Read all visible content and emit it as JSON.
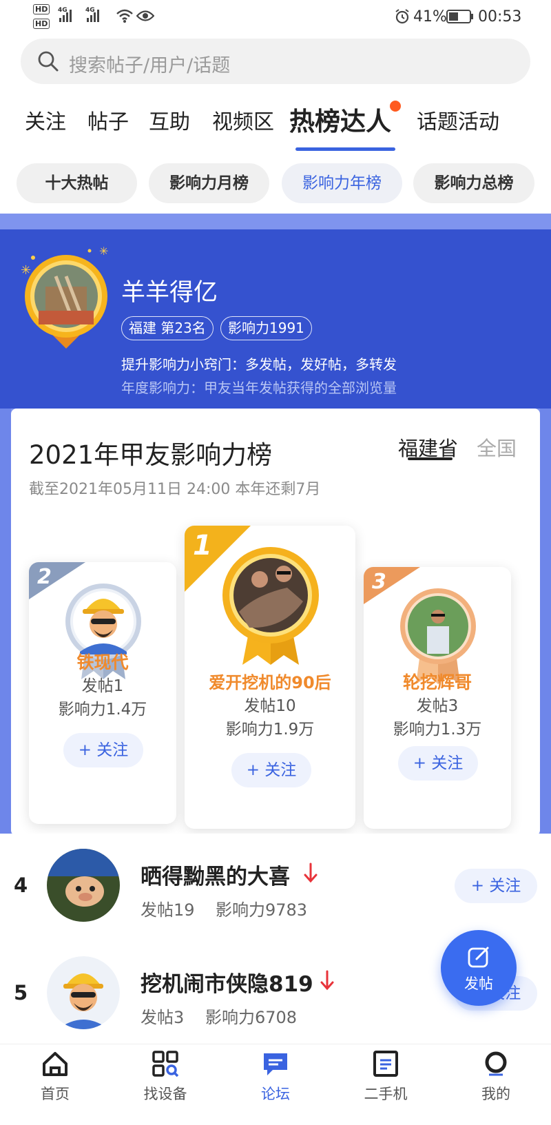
{
  "status": {
    "net1": "HD",
    "net2": "HD",
    "sig1": "4G",
    "sig2": "4G",
    "battery": "41%",
    "time": "00:53"
  },
  "search": {
    "placeholder": "搜索帖子/用户/话题"
  },
  "tabs": [
    {
      "label": "关注"
    },
    {
      "label": "帖子"
    },
    {
      "label": "互助"
    },
    {
      "label": "视频区"
    },
    {
      "label": "热榜达人"
    },
    {
      "label": "话题活动"
    }
  ],
  "chips": [
    {
      "label": "十大热帖"
    },
    {
      "label": "影响力月榜"
    },
    {
      "label": "影响力年榜"
    },
    {
      "label": "影响力总榜"
    }
  ],
  "me": {
    "name": "羊羊得亿",
    "region_rank": "福建 第23名",
    "influence": "影响力1991",
    "tip": "提升影响力小窍门：多发帖，发好帖，多转发",
    "desc": "年度影响力：甲友当年发帖获得的全部浏览量"
  },
  "board": {
    "title": "2021年甲友影响力榜",
    "subtitle": "截至2021年05月11日 24:00 本年还剩7月",
    "region_tabs": [
      "福建省",
      "全国"
    ]
  },
  "podium": {
    "second": {
      "rank": "2",
      "name": "铁现代",
      "posts": "发帖1",
      "influence": "影响力1.4万",
      "follow": "+ 关注"
    },
    "first": {
      "rank": "1",
      "name": "爱开挖机的90后",
      "posts": "发帖10",
      "influence": "影响力1.9万",
      "follow": "+ 关注"
    },
    "third": {
      "rank": "3",
      "name": "轮挖辉哥",
      "posts": "发帖3",
      "influence": "影响力1.3万",
      "follow": "+ 关注"
    }
  },
  "list": [
    {
      "rank": "4",
      "name": "晒得黝黑的大喜",
      "posts": "发帖19",
      "influence": "影响力9783",
      "follow": "+ 关注"
    },
    {
      "rank": "5",
      "name": "挖机闹市侠隐819",
      "posts": "发帖3",
      "influence": "影响力6708",
      "follow": "+ 关注"
    }
  ],
  "fab": {
    "label": "发帖"
  },
  "nav": [
    {
      "label": "首页"
    },
    {
      "label": "找设备"
    },
    {
      "label": "论坛"
    },
    {
      "label": "二手机"
    },
    {
      "label": "我的"
    }
  ],
  "colors": {
    "accent": "#3a63e0",
    "header": "#3552cf",
    "orange": "#f08a2c",
    "trend_down": "#e8333a"
  }
}
